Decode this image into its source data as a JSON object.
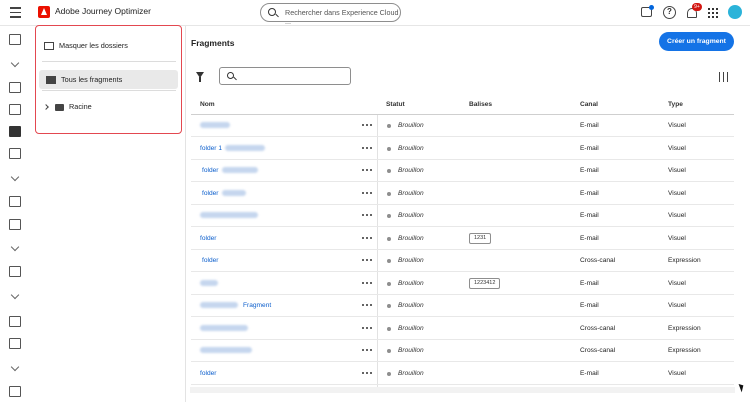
{
  "app": {
    "title": "Adobe Journey Optimizer",
    "search_placeholder": "Rechercher dans Experience Cloud ...",
    "notification_count": "9+"
  },
  "panel": {
    "hide_label": "Masquer les dossiers",
    "all_label": "Tous les fragments",
    "root_label": "Racine"
  },
  "page": {
    "title": "Fragments",
    "create_label": "Créer un fragment"
  },
  "table": {
    "headers": {
      "name": "Nom",
      "status": "Statut",
      "tags": "Balises",
      "channel": "Canal",
      "type": "Type"
    },
    "rows": [
      {
        "name": "",
        "blur": true,
        "status": "Brouillon",
        "tag": "",
        "channel": "E-mail",
        "type": "Visuel"
      },
      {
        "name": "folder 1",
        "blur": true,
        "status": "Brouillon",
        "tag": "",
        "channel": "E-mail",
        "type": "Visuel"
      },
      {
        "name": "folder",
        "blur": true,
        "status": "Brouillon",
        "tag": "",
        "channel": "E-mail",
        "type": "Visuel"
      },
      {
        "name": "folder",
        "blur": true,
        "status": "Brouillon",
        "tag": "",
        "channel": "E-mail",
        "type": "Visuel"
      },
      {
        "name": "",
        "blur": true,
        "status": "Brouillon",
        "tag": "",
        "channel": "E-mail",
        "type": "Visuel"
      },
      {
        "name": "folder",
        "blur": false,
        "status": "Brouillon",
        "tag": "1231",
        "channel": "E-mail",
        "type": "Visuel"
      },
      {
        "name": "folder",
        "blur": false,
        "status": "Brouillon",
        "tag": "",
        "channel": "Cross-canal",
        "type": "Expression"
      },
      {
        "name": "",
        "blur": true,
        "status": "Brouillon",
        "tag": "1223412",
        "channel": "E-mail",
        "type": "Visuel"
      },
      {
        "name": "Fragment",
        "blur": true,
        "status": "Brouillon",
        "tag": "",
        "channel": "E-mail",
        "type": "Visuel"
      },
      {
        "name": "",
        "blur": true,
        "status": "Brouillon",
        "tag": "",
        "channel": "Cross-canal",
        "type": "Expression"
      },
      {
        "name": "",
        "blur": true,
        "status": "Brouillon",
        "tag": "",
        "channel": "Cross-canal",
        "type": "Expression"
      },
      {
        "name": "folder",
        "blur": false,
        "status": "Brouillon",
        "tag": "",
        "channel": "E-mail",
        "type": "Visuel"
      }
    ]
  }
}
